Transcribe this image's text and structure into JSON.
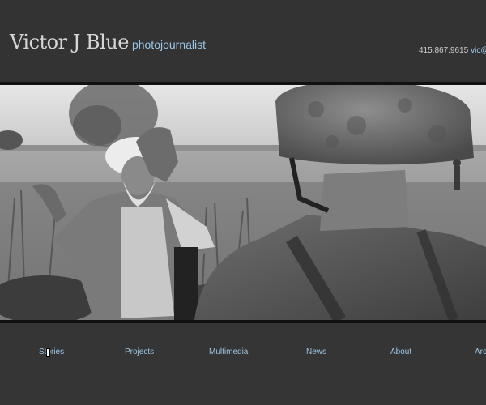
{
  "header": {
    "name": "Victor J Blue",
    "tagline": "photojournalist",
    "phone": "415.867.9615",
    "email": "vic@v"
  },
  "photo": {
    "alt": "Black and white photo of an elderly Afghan man in a turban gesturing toward a helmeted soldier in a field"
  },
  "nav": {
    "items": [
      {
        "label": "Stories"
      },
      {
        "label": "Projects"
      },
      {
        "label": "Multimedia"
      },
      {
        "label": "News"
      },
      {
        "label": "About"
      },
      {
        "label": "Arc"
      }
    ]
  },
  "colors": {
    "background": "#353535",
    "link": "#9cc6e6",
    "logo_text": "#d6d6d6"
  }
}
